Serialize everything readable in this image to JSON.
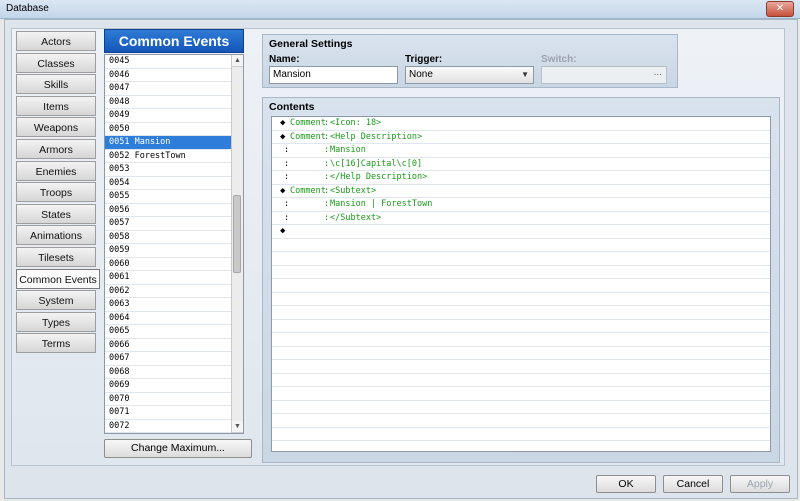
{
  "window": {
    "title": "Database",
    "close_glyph": "✕"
  },
  "nav": {
    "items": [
      {
        "label": "Actors"
      },
      {
        "label": "Classes"
      },
      {
        "label": "Skills"
      },
      {
        "label": "Items"
      },
      {
        "label": "Weapons"
      },
      {
        "label": "Armors"
      },
      {
        "label": "Enemies"
      },
      {
        "label": "Troops"
      },
      {
        "label": "States"
      },
      {
        "label": "Animations"
      },
      {
        "label": "Tilesets"
      },
      {
        "label": "Common Events",
        "selected": true
      },
      {
        "label": "System"
      },
      {
        "label": "Types"
      },
      {
        "label": "Terms"
      }
    ]
  },
  "list": {
    "title": "Common Events",
    "rows": [
      "0045",
      "0046",
      "0047",
      "0048",
      "0049",
      "0050",
      "0051 Mansion",
      "0052 ForestTown",
      "0053",
      "0054",
      "0055",
      "0056",
      "0057",
      "0058",
      "0059",
      "0060",
      "0061",
      "0062",
      "0063",
      "0064",
      "0065",
      "0066",
      "0067",
      "0068",
      "0069",
      "0070",
      "0071",
      "0072"
    ],
    "selected_index": 6,
    "scroll_up": "▲",
    "scroll_down": "▼",
    "change_maximum_label": "Change Maximum..."
  },
  "general": {
    "title": "General Settings",
    "name_label": "Name:",
    "name_value": "Mansion",
    "trigger_label": "Trigger:",
    "trigger_value": "None",
    "trigger_caret": "▼",
    "switch_label": "Switch:",
    "switch_dots": "..."
  },
  "contents": {
    "title": "Contents",
    "lines": [
      {
        "prefix": "◆",
        "keyword": "Comment",
        "sep": ":",
        "text": "<Icon: 18>"
      },
      {
        "prefix": "◆",
        "keyword": "Comment",
        "sep": ":",
        "text": "<Help Description>"
      },
      {
        "prefix": ":",
        "keyword": "",
        "sep": ":",
        "text": "Mansion"
      },
      {
        "prefix": ":",
        "keyword": "",
        "sep": ":",
        "text": "\\c[16]Capital\\c[0]"
      },
      {
        "prefix": ":",
        "keyword": "",
        "sep": ":",
        "text": "</Help Description>"
      },
      {
        "prefix": "◆",
        "keyword": "Comment",
        "sep": ":",
        "text": "<Subtext>"
      },
      {
        "prefix": ":",
        "keyword": "",
        "sep": ":",
        "text": "Mansion | ForestTown"
      },
      {
        "prefix": ":",
        "keyword": "",
        "sep": ":",
        "text": "</Subtext>"
      },
      {
        "prefix": "◆",
        "keyword": "",
        "sep": "",
        "text": ""
      }
    ]
  },
  "buttons": {
    "ok": "OK",
    "cancel": "Cancel",
    "apply": "Apply"
  }
}
